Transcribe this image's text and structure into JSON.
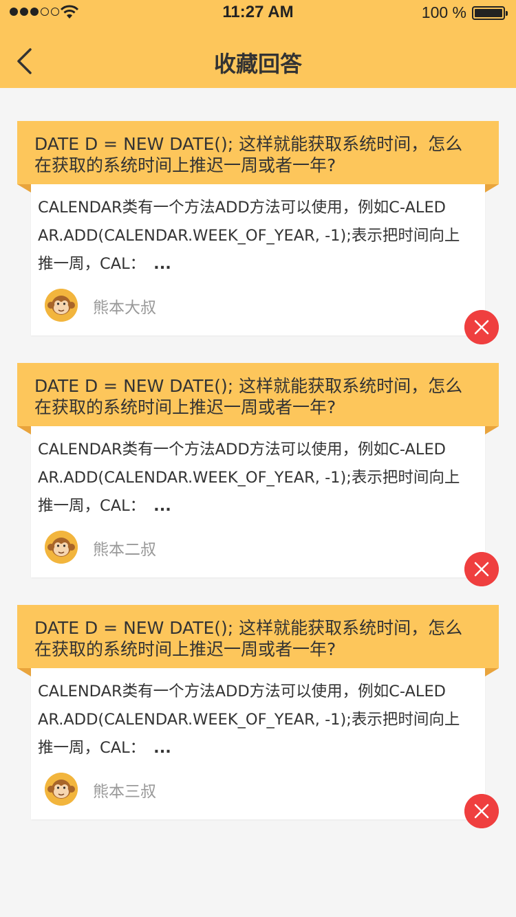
{
  "status_bar": {
    "time": "11:27 AM",
    "battery": "100 %",
    "signal_icon": "signal-dots-icon",
    "wifi_icon": "wifi-icon",
    "battery_icon": "battery-icon"
  },
  "nav": {
    "title": "收藏回答",
    "back_icon": "back-chevron-icon"
  },
  "colors": {
    "accent": "#fdc65b",
    "fold": "#e9a43c",
    "delete": "#ef3f3f",
    "background": "#f5f5f5"
  },
  "cards": [
    {
      "question_line1": "DATE D = NEW DATE(); 这样就能获取系统时间，怎么",
      "question_line2": "在获取的系统时间上推迟一周或者一年?",
      "answer_line1": "CALENDAR类有一个方法ADD方法可以使用，例如C-ALED",
      "answer_line2": "AR.ADD(CALENDAR.WEEK_OF_YEAR, -1);表示把时间向上",
      "answer_line3": "推一周，CAL：",
      "ellipsis": "...",
      "author": "熊本大叔"
    },
    {
      "question_line1": "DATE D = NEW DATE(); 这样就能获取系统时间，怎么",
      "question_line2": "在获取的系统时间上推迟一周或者一年?",
      "answer_line1": "CALENDAR类有一个方法ADD方法可以使用，例如C-ALED",
      "answer_line2": "AR.ADD(CALENDAR.WEEK_OF_YEAR, -1);表示把时间向上",
      "answer_line3": "推一周，CAL：",
      "ellipsis": "...",
      "author": "熊本二叔"
    },
    {
      "question_line1": "DATE D = NEW DATE(); 这样就能获取系统时间，怎么",
      "question_line2": "在获取的系统时间上推迟一周或者一年?",
      "answer_line1": "CALENDAR类有一个方法ADD方法可以使用，例如C-ALED",
      "answer_line2": "AR.ADD(CALENDAR.WEEK_OF_YEAR, -1);表示把时间向上",
      "answer_line3": "推一周，CAL：",
      "ellipsis": "...",
      "author": "熊本三叔"
    }
  ]
}
